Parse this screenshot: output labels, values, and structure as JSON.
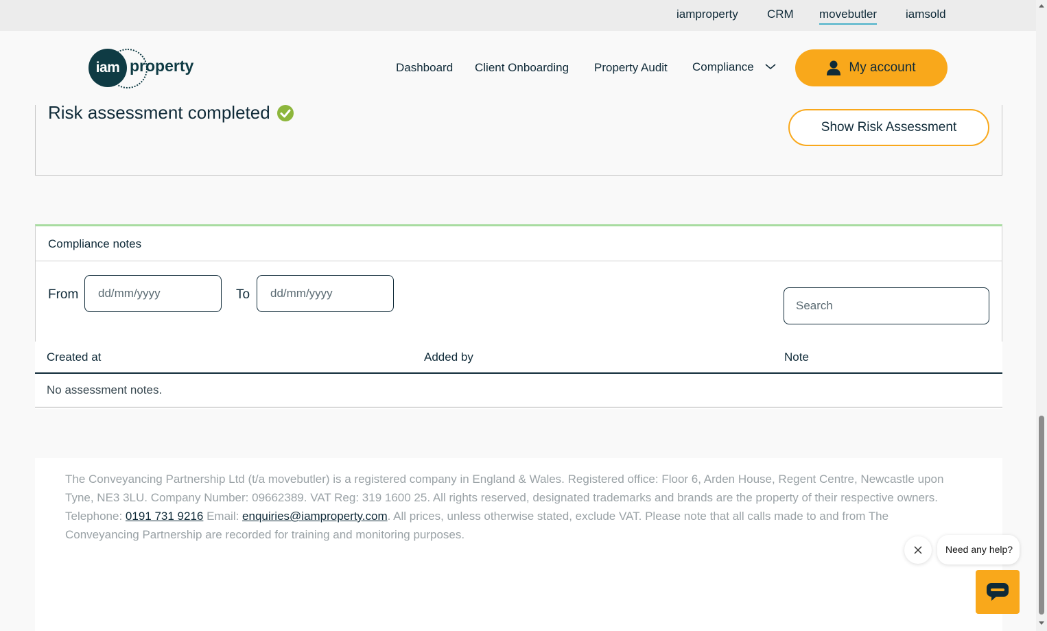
{
  "topbar": {
    "links": [
      "iamproperty",
      "CRM",
      "movebutler",
      "iamsold"
    ],
    "active": "movebutler"
  },
  "brand": {
    "logo_iam": "iam",
    "logo_property": "property",
    "primary_color": "#0f3b44",
    "accent_color": "#f9a81b"
  },
  "nav": {
    "dashboard": "Dashboard",
    "client_onboarding": "Client Onboarding",
    "property_audit": "Property Audit",
    "compliance": "Compliance",
    "my_account": "My account"
  },
  "risk": {
    "title": "Risk assessment completed",
    "show_button": "Show Risk Assessment",
    "status_color": "#8db63c"
  },
  "notes": {
    "title": "Compliance notes",
    "from_label": "From",
    "to_label": "To",
    "date_placeholder": "dd/mm/yyyy",
    "search_placeholder": "Search",
    "columns": [
      "Created at",
      "Added by",
      "Note"
    ],
    "empty_message": "No assessment notes."
  },
  "footer": {
    "text_1": "The Conveyancing Partnership Ltd (t/a movebutler) is a registered company in England & Wales. Registered office: Floor 6, Arden House, Regent Centre, Newcastle upon Tyne, NE3 3LU. Company Number: 09662389. VAT Reg: 319 1600 25. All rights reserved, designated trademarks and brands are the property of their respective owners. Telephone: ",
    "phone": "0191 731 9216",
    "text_2": " Email: ",
    "email": "enquiries@iamproperty.com",
    "text_3": ". All prices, unless otherwise stated, exclude VAT. Please note that all calls made to and from The Conveyancing Partnership are recorded for training and monitoring purposes."
  },
  "chat": {
    "prompt": "Need any help?"
  }
}
